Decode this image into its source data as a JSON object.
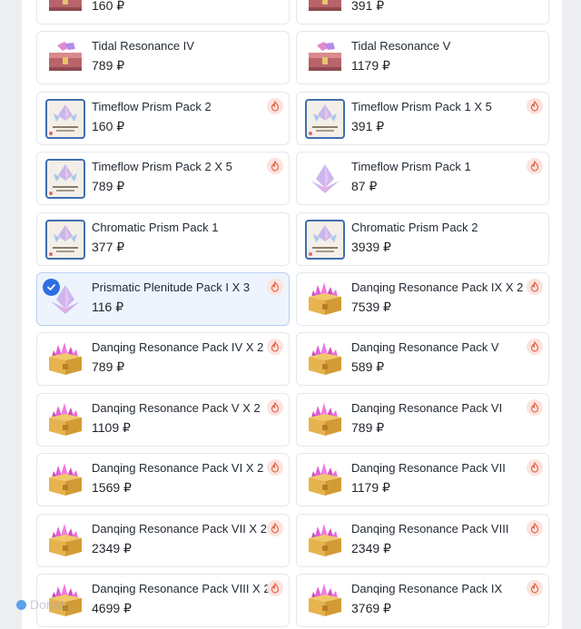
{
  "watermark": {
    "text": "Donat..."
  },
  "colors": {
    "accent": "#2f6fe4",
    "hot_badge_bg": "#fbe3de",
    "hot_badge_fg": "#e2664a",
    "selected_bg": "#eef4fd"
  },
  "items": [
    {
      "title": "",
      "price": "160 ₽",
      "icon": "chest-icon",
      "hot": false,
      "selected": false
    },
    {
      "title": "",
      "price": "391 ₽",
      "icon": "chest-icon",
      "hot": false,
      "selected": false
    },
    {
      "title": "Tidal Resonance IV",
      "price": "789 ₽",
      "icon": "chest-icon",
      "hot": false,
      "selected": false
    },
    {
      "title": "Tidal Resonance V",
      "price": "1179 ₽",
      "icon": "chest-icon",
      "hot": false,
      "selected": false
    },
    {
      "title": "Timeflow Prism Pack 2",
      "price": "160 ₽",
      "icon": "prism-card-icon",
      "hot": true,
      "selected": false
    },
    {
      "title": "Timeflow Prism Pack 1 X 5",
      "price": "391 ₽",
      "icon": "prism-card-icon",
      "hot": true,
      "selected": false
    },
    {
      "title": "Timeflow Prism Pack 2 X 5",
      "price": "789 ₽",
      "icon": "prism-card-icon",
      "hot": true,
      "selected": false
    },
    {
      "title": "Timeflow Prism Pack 1",
      "price": "87 ₽",
      "icon": "crystal-icon",
      "hot": true,
      "selected": false
    },
    {
      "title": "Chromatic Prism Pack 1",
      "price": "377 ₽",
      "icon": "prism-card-icon",
      "hot": false,
      "selected": false
    },
    {
      "title": "Chromatic Prism Pack 2",
      "price": "3939 ₽",
      "icon": "prism-card-icon",
      "hot": false,
      "selected": false
    },
    {
      "title": "Prismatic Plenitude Pack I X 3",
      "price": "116 ₽",
      "icon": "crystal-icon",
      "hot": true,
      "selected": true
    },
    {
      "title": "Danqing Resonance Pack IX X 2",
      "price": "7539 ₽",
      "icon": "gold-chest-icon",
      "hot": true,
      "selected": false
    },
    {
      "title": "Danqing Resonance Pack IV X 2",
      "price": "789 ₽",
      "icon": "gold-chest-icon",
      "hot": true,
      "selected": false
    },
    {
      "title": "Danqing Resonance Pack V",
      "price": "589 ₽",
      "icon": "gold-chest-icon",
      "hot": true,
      "selected": false
    },
    {
      "title": "Danqing Resonance Pack V X 2",
      "price": "1109 ₽",
      "icon": "gold-chest-icon",
      "hot": true,
      "selected": false
    },
    {
      "title": "Danqing Resonance Pack VI",
      "price": "789 ₽",
      "icon": "gold-chest-icon",
      "hot": true,
      "selected": false
    },
    {
      "title": "Danqing Resonance Pack VI X 2",
      "price": "1569 ₽",
      "icon": "gold-chest-icon",
      "hot": true,
      "selected": false
    },
    {
      "title": "Danqing Resonance Pack VII",
      "price": "1179 ₽",
      "icon": "gold-chest-icon",
      "hot": true,
      "selected": false
    },
    {
      "title": "Danqing Resonance Pack VII X 2",
      "price": "2349 ₽",
      "icon": "gold-chest-icon",
      "hot": true,
      "selected": false
    },
    {
      "title": "Danqing Resonance Pack VIII",
      "price": "2349 ₽",
      "icon": "gold-chest-icon",
      "hot": true,
      "selected": false
    },
    {
      "title": "Danqing Resonance Pack VIII X 2",
      "price": "4699 ₽",
      "icon": "gold-chest-icon",
      "hot": true,
      "selected": false
    },
    {
      "title": "Danqing Resonance Pack IX",
      "price": "3769 ₽",
      "icon": "gold-chest-icon",
      "hot": true,
      "selected": false
    }
  ]
}
